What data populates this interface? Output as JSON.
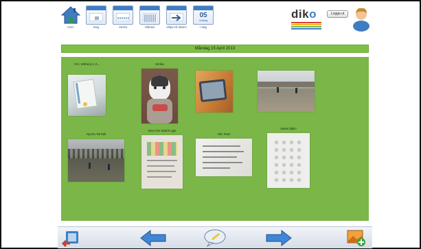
{
  "toolbar": {
    "home_label": "Hem",
    "day_label": "Dag",
    "week_label": "Vecka",
    "month_label": "Månad",
    "pick_date_label": "Välja ett datum",
    "today_label": "I dag",
    "today_number": "05",
    "today_sub": "Onsdag",
    "logout_label": "Logga ut"
  },
  "logo": {
    "text_d": "d",
    "text_i": "i",
    "text_k": "k",
    "text_o": "o"
  },
  "date_header": "Måndag 15 April 2013",
  "tiles": [
    {
      "caption": "Fel i Witheny 2.3..."
    },
    {
      "caption": "Simba"
    },
    {
      "caption": ""
    },
    {
      "caption": ""
    },
    {
      "caption": "Sports Tal ball"
    },
    {
      "caption": "Dess her Matchi ggs"
    },
    {
      "caption": "Min iPad"
    },
    {
      "caption": "raskel djikt?"
    }
  ],
  "colors": {
    "accent_green": "#7ab648",
    "accent_blue": "#3d7fc6",
    "logo_stripes": [
      "#e23a2e",
      "#f1b41c",
      "#7ab648",
      "#3d7fc6"
    ]
  },
  "icons": {
    "home": "home-icon",
    "day": "calendar-day-icon",
    "week": "calendar-week-icon",
    "month": "calendar-month-icon",
    "pick_date": "calendar-arrow-icon",
    "today": "calendar-today-icon",
    "user": "user-icon",
    "back": "back-icon",
    "prev": "arrow-left-icon",
    "comment": "speech-bubble-icon",
    "next": "arrow-right-icon",
    "add_image": "add-image-icon"
  }
}
